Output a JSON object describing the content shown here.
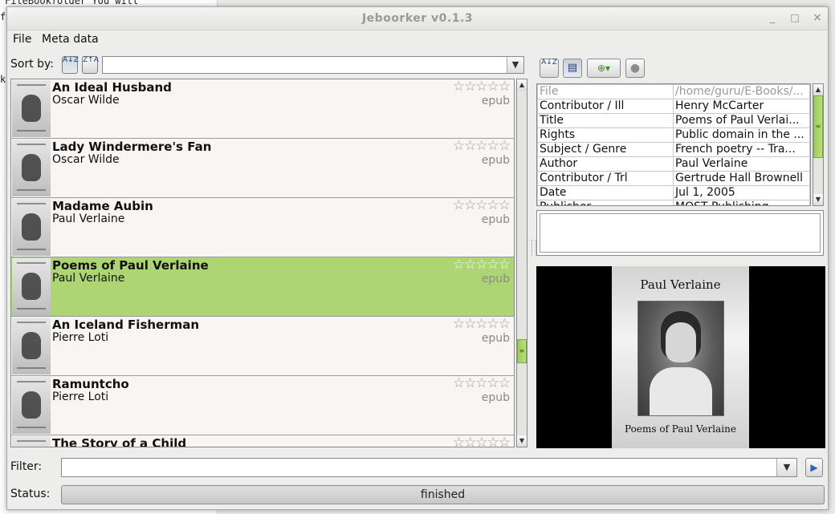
{
  "background": {
    "line1": "    FileBookfolder  You will",
    "line2": "fr",
    "line3": "k"
  },
  "window": {
    "title": "Jeboorker v0.1.3",
    "minimize_glyph": "_",
    "maximize_glyph": "□",
    "close_glyph": "×"
  },
  "menu": [
    "File",
    "Meta data"
  ],
  "sort": {
    "label": "Sort by:",
    "asc_icon": "A↓Z",
    "desc_icon": "Z↑A",
    "value": "",
    "dropdown_glyph": "▼"
  },
  "books": [
    {
      "title": "An Ideal Husband",
      "author": "Oscar Wilde",
      "format": "epub",
      "rating": "☆☆☆☆☆",
      "selected": false
    },
    {
      "title": "Lady Windermere's Fan",
      "author": "Oscar Wilde",
      "format": "epub",
      "rating": "☆☆☆☆☆",
      "selected": false
    },
    {
      "title": "Madame Aubin",
      "author": "Paul Verlaine",
      "format": "epub",
      "rating": "☆☆☆☆☆",
      "selected": false
    },
    {
      "title": "Poems of Paul Verlaine",
      "author": "Paul Verlaine",
      "format": "epub",
      "rating": "☆☆☆☆☆",
      "selected": true
    },
    {
      "title": "An Iceland Fisherman",
      "author": "Pierre Loti",
      "format": "epub",
      "rating": "☆☆☆☆☆",
      "selected": false
    },
    {
      "title": "Ramuntcho",
      "author": "Pierre Loti",
      "format": "epub",
      "rating": "☆☆☆☆☆",
      "selected": false
    },
    {
      "title": "The Story of a Child",
      "author": "",
      "format": "",
      "rating": "☆☆☆☆☆",
      "selected": false
    }
  ],
  "scroll_glyphs": {
    "up": "▲",
    "down": "▼",
    "grip": "≡"
  },
  "meta_toolbar": {
    "sort_icon": "A↓Z",
    "list_icon": "▤",
    "add_icon": "⊕▾",
    "stop_icon": "●"
  },
  "metadata": [
    {
      "key": "File",
      "value": "/home/guru/E-Books/...",
      "dim": true
    },
    {
      "key": "Contributor / Ill",
      "value": "Henry McCarter",
      "dim": false
    },
    {
      "key": "Title",
      "value": "Poems of Paul Verlai...",
      "dim": false
    },
    {
      "key": "Rights",
      "value": "Public domain in the ...",
      "dim": false
    },
    {
      "key": "Subject / Genre",
      "value": "French poetry -- Tra...",
      "dim": false
    },
    {
      "key": "Author",
      "value": "Paul Verlaine",
      "dim": false
    },
    {
      "key": "Contributor / Trl",
      "value": "Gertrude Hall Brownell",
      "dim": false
    },
    {
      "key": "Date",
      "value": "Jul 1, 2005",
      "dim": false
    },
    {
      "key": "Publisher",
      "value": "MOST Publishing",
      "dim": false
    }
  ],
  "cover": {
    "author": "Paul Verlaine",
    "title": "Poems of Paul Verlaine"
  },
  "filter": {
    "label": "Filter:",
    "value": "",
    "dropdown_glyph": "▼",
    "apply_glyph": "▶"
  },
  "status": {
    "label": "Status:",
    "text": "finished"
  }
}
